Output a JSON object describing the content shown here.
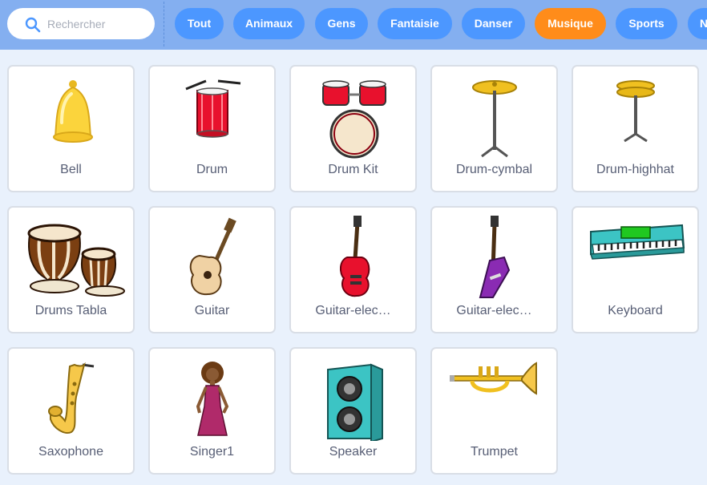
{
  "search": {
    "placeholder": "Rechercher",
    "icon": "search-icon"
  },
  "categories": [
    {
      "label": "Tout"
    },
    {
      "label": "Animaux"
    },
    {
      "label": "Gens"
    },
    {
      "label": "Fantaisie"
    },
    {
      "label": "Danser"
    },
    {
      "label": "Musique",
      "active": true
    },
    {
      "label": "Sports"
    },
    {
      "label": "N"
    }
  ],
  "sprites": [
    {
      "name": "Bell",
      "icon": "bell-icon"
    },
    {
      "name": "Drum",
      "icon": "drum-icon"
    },
    {
      "name": "Drum Kit",
      "icon": "drum-kit-icon"
    },
    {
      "name": "Drum-cymbal",
      "icon": "cymbal-icon"
    },
    {
      "name": "Drum-highhat",
      "icon": "hihat-icon"
    },
    {
      "name": "Drums Tabla",
      "icon": "tabla-icon"
    },
    {
      "name": "Guitar",
      "icon": "guitar-icon"
    },
    {
      "name": "Guitar-elec…",
      "icon": "electric-guitar-icon"
    },
    {
      "name": "Guitar-elec…",
      "icon": "electric-guitar-v-icon"
    },
    {
      "name": "Keyboard",
      "icon": "keyboard-icon"
    },
    {
      "name": "Saxophone",
      "icon": "saxophone-icon"
    },
    {
      "name": "Singer1",
      "icon": "singer-icon"
    },
    {
      "name": "Speaker",
      "icon": "speaker-icon"
    },
    {
      "name": "Trumpet",
      "icon": "trumpet-icon"
    }
  ],
  "colors": {
    "topbar": "#84aff0",
    "pill": "#4c97ff",
    "pill_active": "#ff8c1a",
    "background": "#e9f1fc",
    "label": "#575e75"
  }
}
